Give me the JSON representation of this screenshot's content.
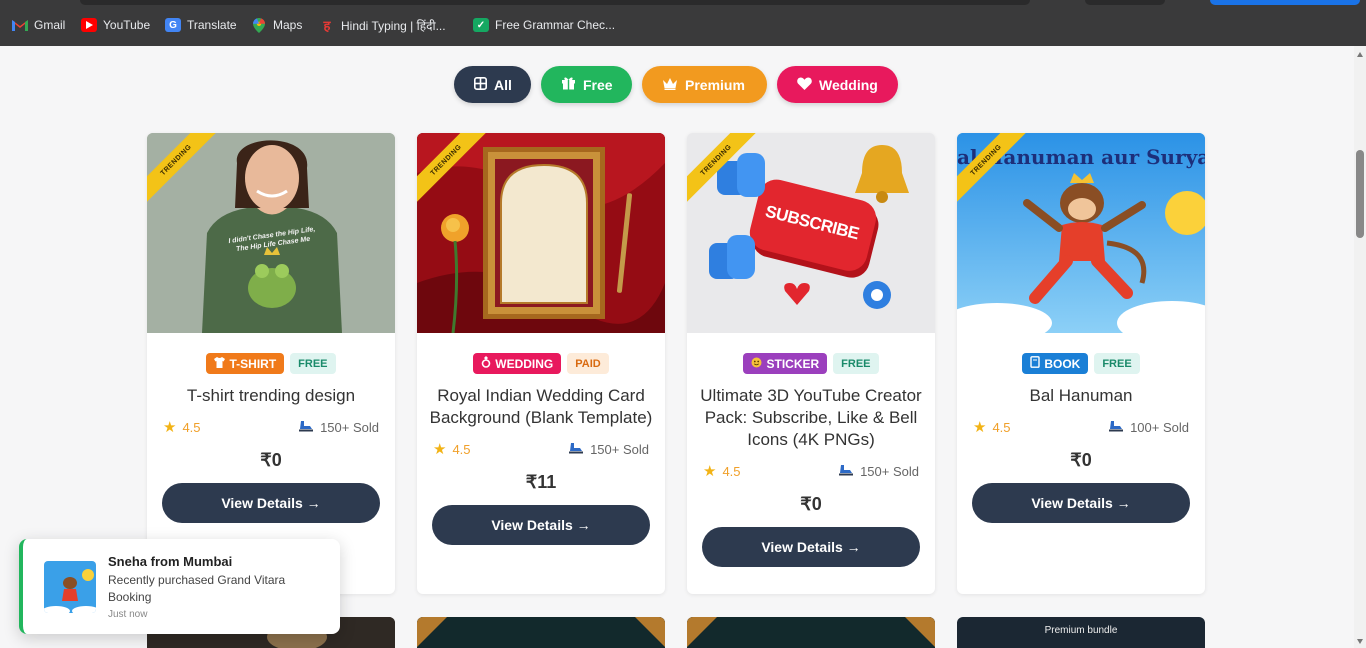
{
  "bookmarks": [
    {
      "label": "Gmail",
      "icon": "gmail-icon"
    },
    {
      "label": "YouTube",
      "icon": "youtube-icon"
    },
    {
      "label": "Translate",
      "icon": "translate-icon"
    },
    {
      "label": "Maps",
      "icon": "maps-icon"
    },
    {
      "label": "Hindi Typing | हिंदी...",
      "icon": "hindi-typing-icon"
    },
    {
      "label": "Free Grammar Chec...",
      "icon": "grammar-icon"
    }
  ],
  "filters": [
    {
      "label": "All",
      "icon": "grid-icon",
      "color": "#2d3a4f"
    },
    {
      "label": "Free",
      "icon": "gift-icon",
      "color": "#22b65d"
    },
    {
      "label": "Premium",
      "icon": "crown-icon",
      "color": "#f29a1f"
    },
    {
      "label": "Wedding",
      "icon": "heart-icon",
      "color": "#e8195d"
    }
  ],
  "products": [
    {
      "ribbon": "TRENDING",
      "category": "T-SHIRT",
      "category_icon": "shirt-icon",
      "price_type": "FREE",
      "title": "T-shirt trending design",
      "rating": "4.5",
      "sold": "150+ Sold",
      "price": "₹0",
      "button": "View Details →",
      "image_text": "I didn't Chase the Hip Life, The Hip Life Chase Me"
    },
    {
      "ribbon": "TRENDING",
      "category": "WEDDING",
      "category_icon": "ring-icon",
      "price_type": "PAID",
      "title": "Royal Indian Wedding Card Background (Blank Template)",
      "rating": "4.5",
      "sold": "150+ Sold",
      "price": "₹11",
      "button": "View Details →"
    },
    {
      "ribbon": "TRENDING",
      "category": "STICKER",
      "category_icon": "sticker-icon",
      "price_type": "FREE",
      "title": "Ultimate 3D YouTube Creator Pack: Subscribe, Like & Bell Icons (4K PNGs)",
      "rating": "4.5",
      "sold": "150+ Sold",
      "price": "₹0",
      "button": "View Details →",
      "image_text": "SUBSCRIBE"
    },
    {
      "ribbon": "TRENDING",
      "category": "BOOK",
      "category_icon": "book-icon",
      "price_type": "FREE",
      "title": "Bal Hanuman",
      "rating": "4.5",
      "sold": "100+ Sold",
      "price": "₹0",
      "button": "View Details →",
      "image_text": "al Hanuman aur Surya D"
    }
  ],
  "row2": {
    "label_4": "Premium bundle"
  },
  "toast": {
    "name": "Sneha from Mumbai",
    "message": "Recently purchased Grand Vitara Booking",
    "time": "Just now"
  }
}
